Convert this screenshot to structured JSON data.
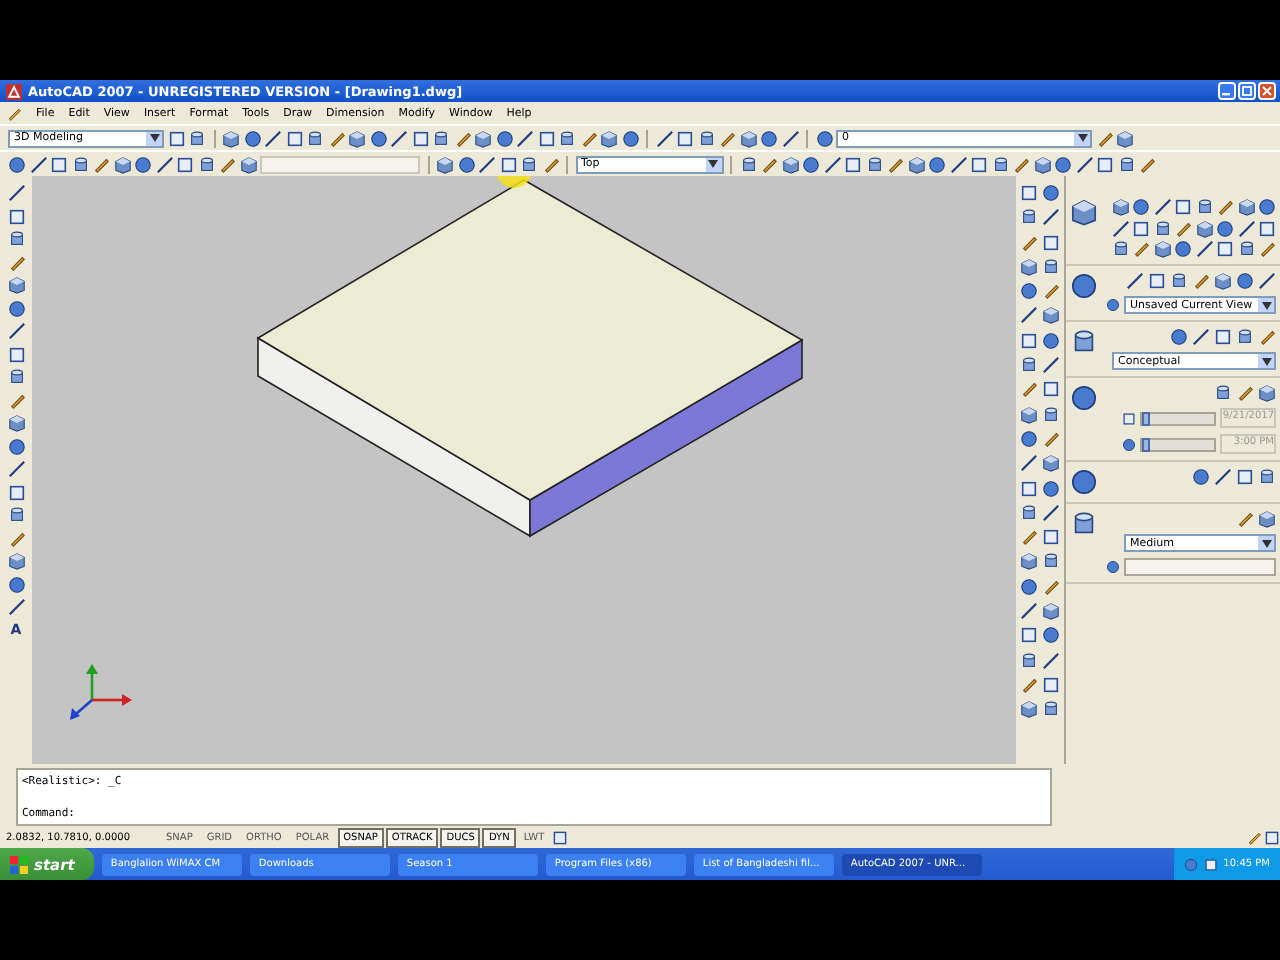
{
  "window": {
    "title": "AutoCAD 2007 - UNREGISTERED VERSION - [Drawing1.dwg]"
  },
  "menu": [
    "File",
    "Edit",
    "View",
    "Insert",
    "Format",
    "Tools",
    "Draw",
    "Dimension",
    "Modify",
    "Window",
    "Help"
  ],
  "toolbars": {
    "workspace": "3D Modeling",
    "layer": "0",
    "view": "Top"
  },
  "left_toolbar": {
    "text_tool": "A"
  },
  "palette": {
    "named_view": "Unsaved Current View",
    "visual_style": "Conceptual",
    "sun_date": "9/21/2017",
    "date_slider": {
      "level": 0
    },
    "sun_time": "3:00 PM",
    "time_slider": {
      "level": 0
    },
    "render_preset": "Medium"
  },
  "command_lines": [
    "<Realistic>: _C",
    "Command:"
  ],
  "status_bar": {
    "coordinates": "2.0832, 10.7810, 0.0000",
    "buttons": [
      {
        "label": "SNAP",
        "on": false
      },
      {
        "label": "GRID",
        "on": false
      },
      {
        "label": "ORTHO",
        "on": false
      },
      {
        "label": "POLAR",
        "on": false
      },
      {
        "label": "OSNAP",
        "on": true
      },
      {
        "label": "OTRACK",
        "on": true
      },
      {
        "label": "DUCS",
        "on": true
      },
      {
        "label": "DYN",
        "on": true
      },
      {
        "label": "LWT",
        "on": false
      }
    ]
  },
  "taskbar": {
    "start": "start",
    "items": [
      {
        "label": "Banglalion WiMAX CM",
        "selected": false
      },
      {
        "label": "Downloads",
        "selected": false
      },
      {
        "label": "Season 1",
        "selected": false
      },
      {
        "label": "Program Files (x86)",
        "selected": false
      },
      {
        "label": "List of Bangladeshi fil...",
        "selected": false
      },
      {
        "label": "AutoCAD 2007 - UNR...",
        "selected": true
      }
    ],
    "clock": "10:45 PM"
  }
}
